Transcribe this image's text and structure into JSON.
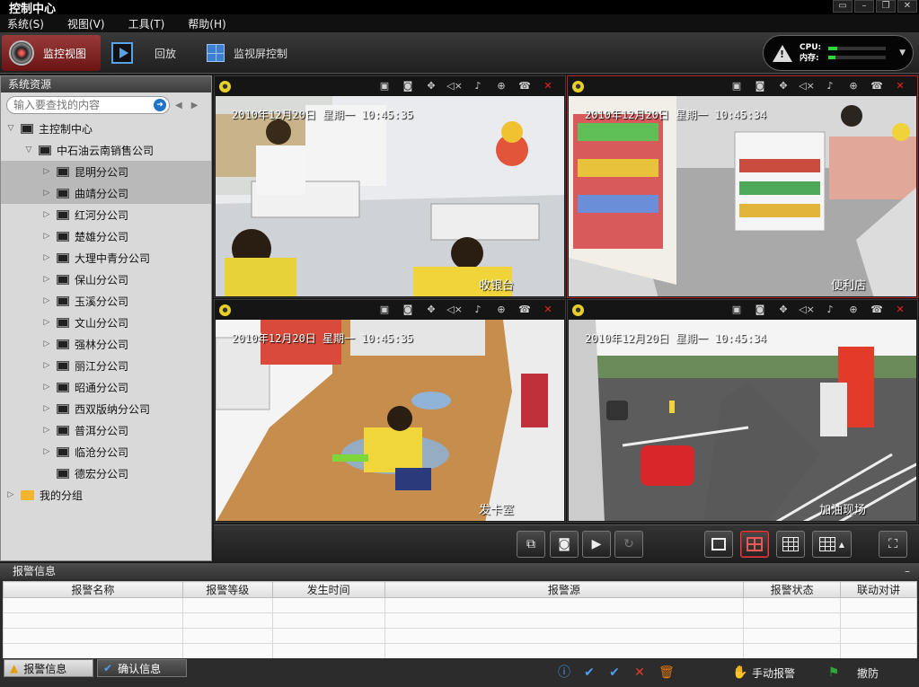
{
  "window": {
    "title": "控制中心",
    "controls": [
      "▭",
      "–",
      "❐",
      "✕"
    ]
  },
  "menu": [
    "系统(S)",
    "视图(V)",
    "工具(T)",
    "帮助(H)"
  ],
  "toolbar": {
    "monitor_view": "监控视图",
    "playback": "回放",
    "wall_control": "监视屏控制",
    "cpu_label": "CPU:",
    "mem_label": "内存:",
    "cpu_level": 0.15,
    "mem_level": 0.12
  },
  "sidebar": {
    "title": "系统资源",
    "search_placeholder": "输入要查找的内容",
    "root": "主控制中心",
    "company": "中石油云南销售公司",
    "branches": [
      "昆明分公司",
      "曲靖分公司",
      "红河分公司",
      "楚雄分公司",
      "大理中青分公司",
      "保山分公司",
      "玉溪分公司",
      "文山分公司",
      "强林分公司",
      "丽江分公司",
      "昭通分公司",
      "西双版纳分公司",
      "普洱分公司",
      "临沧分公司",
      "德宏分公司"
    ],
    "group": "我的分组"
  },
  "video": {
    "panes": [
      {
        "osd": "2010年12月20日 星期一 10:45:35",
        "label": "收银台"
      },
      {
        "osd": "2010年12月20日 星期一 10:45:34",
        "label": "便利店"
      },
      {
        "osd": "2010年12月20日 星期一 10:45:35",
        "label": "发卡室"
      },
      {
        "osd": "2010年12月20日 星期一 10:45:34",
        "label": "加油现场"
      }
    ]
  },
  "alarm": {
    "title": "报警信息",
    "columns": [
      "报警名称",
      "报警等级",
      "发生时间",
      "报警源",
      "报警状态",
      "联动对讲"
    ],
    "tab_alarm": "报警信息",
    "tab_confirm": "确认信息",
    "manual_alarm": "手动报警",
    "disarm": "撤防"
  },
  "colors": {
    "accent": "#b22222",
    "cpu_meter": "#2fd63c",
    "alarm_tab": "#e5e5e5"
  }
}
